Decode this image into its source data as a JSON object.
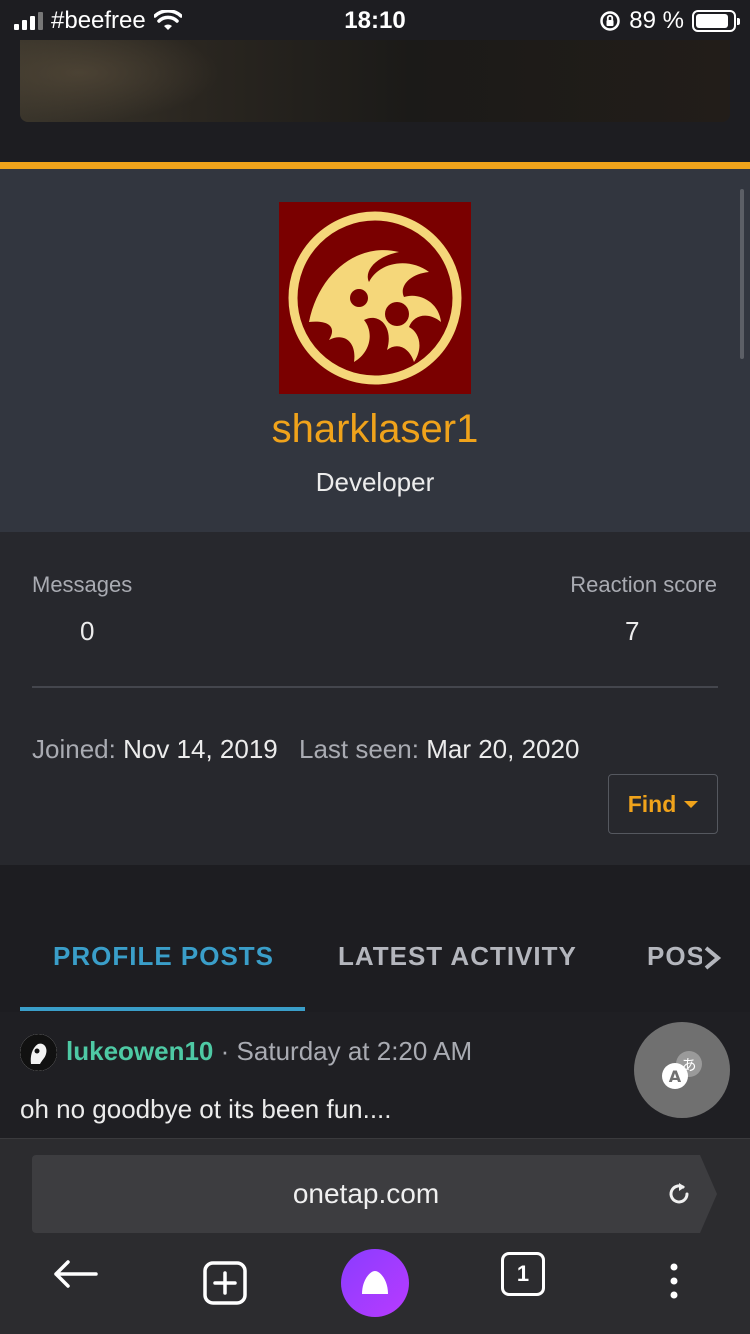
{
  "status_bar": {
    "carrier": "#beefree",
    "time": "18:10",
    "battery": "89 %",
    "battery_level": 0.89
  },
  "profile": {
    "username": "sharklaser1",
    "user_title": "Developer"
  },
  "stats": {
    "messages_label": "Messages",
    "messages_value": "0",
    "reaction_label": "Reaction score",
    "reaction_value": "7",
    "joined_label": "Joined:",
    "joined_value": "Nov 14, 2019",
    "last_seen_label": "Last seen:",
    "last_seen_value": "Mar 20, 2020",
    "find_label": "Find"
  },
  "tabs": {
    "items": [
      "PROFILE POSTS",
      "LATEST ACTIVITY",
      "POSTI"
    ],
    "active_index": 0
  },
  "post": {
    "user": "lukeowen10",
    "separator": "·",
    "time": "Saturday at 2:20 AM",
    "body": "oh no goodbye ot its been fun...."
  },
  "browser": {
    "url": "onetap.com",
    "tab_count": "1"
  },
  "colors": {
    "accent": "#f0a31b",
    "tab_active": "#3a9ec9",
    "username_green": "#4ec9a4",
    "avatar_bg": "#7a0000",
    "avatar_emblem": "#f5d77a"
  }
}
